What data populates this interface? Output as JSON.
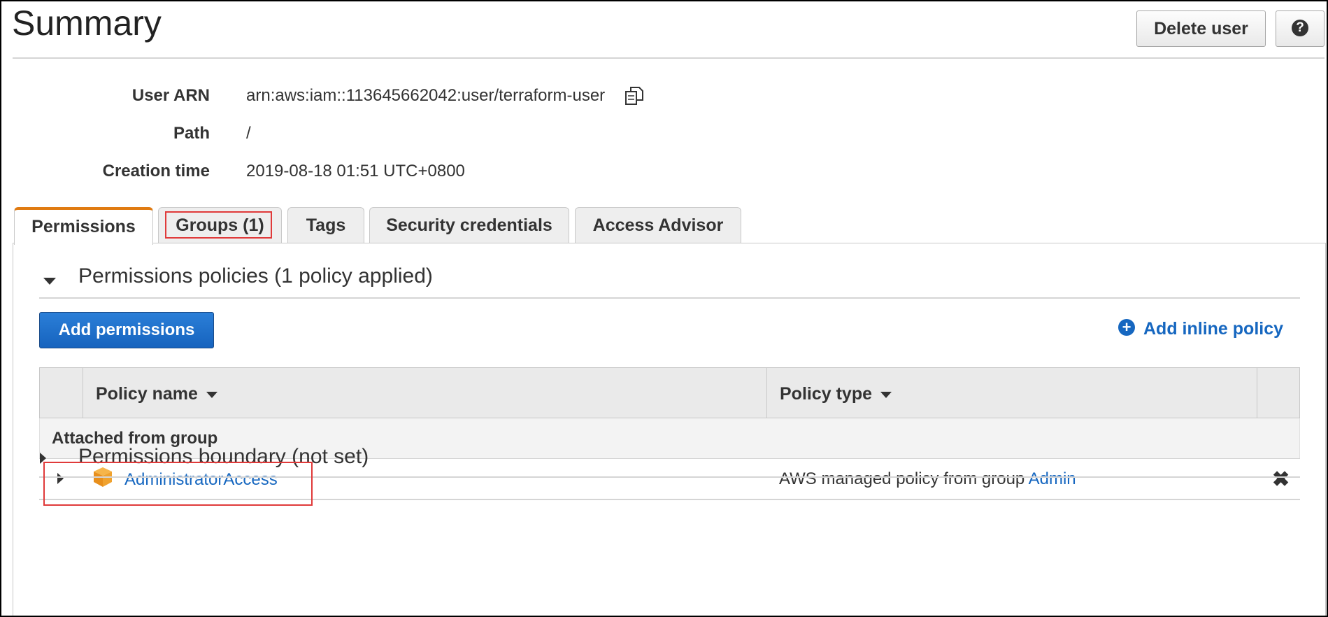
{
  "header": {
    "title": "Summary",
    "delete_label": "Delete user",
    "help_icon": "?"
  },
  "details": {
    "arn_label": "User ARN",
    "arn_value": "arn:aws:iam::113645662042:user/terraform-user",
    "path_label": "Path",
    "path_value": "/",
    "created_label": "Creation time",
    "created_value": "2019-08-18 01:51 UTC+0800"
  },
  "tabs": [
    {
      "label": "Permissions",
      "active": true
    },
    {
      "label": "Groups (1)",
      "active": false
    },
    {
      "label": "Tags",
      "active": false
    },
    {
      "label": "Security credentials",
      "active": false
    },
    {
      "label": "Access Advisor",
      "active": false
    }
  ],
  "permissions": {
    "policies_title": "Permissions policies (1 policy applied)",
    "add_permissions_label": "Add permissions",
    "add_inline_label": "Add inline policy",
    "table": {
      "columns": [
        "Policy name",
        "Policy type"
      ],
      "group_heading": "Attached from group",
      "rows": [
        {
          "name": "AdministratorAccess",
          "type_text": "AWS managed policy from group",
          "group_link": "Admin"
        }
      ]
    },
    "boundary_title": "Permissions boundary (not set)"
  },
  "colors": {
    "link": "#1667c0",
    "primary_button": "#1663be",
    "active_tab_accent": "#e07b12",
    "highlight": "#e03a3a",
    "policy_icon": "#f0a22e"
  },
  "icons": {
    "copy": "copy-icon",
    "policy": "cube-icon",
    "remove": "close-icon",
    "add": "plus-circle-icon"
  }
}
